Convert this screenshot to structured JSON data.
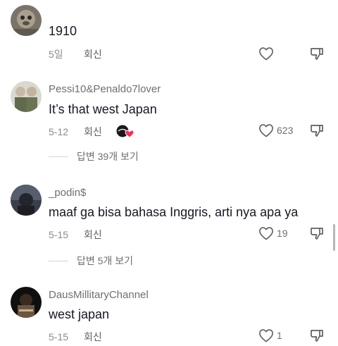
{
  "comments": [
    {
      "username": "",
      "text": "1910",
      "date": "5일",
      "reply_label": "회신",
      "like_count": ""
    },
    {
      "username": "Pessi10&Penaldo7lover",
      "text": "It’s that west Japan",
      "date": "5-12",
      "reply_label": "회신",
      "like_count": "623",
      "view_replies": "답변 39개 보기"
    },
    {
      "username": "_podin$",
      "text": "maaf ga bisa bahasa Inggris, arti nya apa ya",
      "date": "5-15",
      "reply_label": "회신",
      "like_count": "19",
      "view_replies": "답변 5개 보기"
    },
    {
      "username": "DausMillitaryChannel",
      "text": "west japan",
      "date": "5-15",
      "reply_label": "회신",
      "like_count": "1"
    }
  ],
  "icons": {
    "like": "heart-outline-icon",
    "dislike": "thumbs-down-icon",
    "creator_liked": "creator-liked-badge-icon"
  },
  "colors": {
    "text_primary": "#161823",
    "text_secondary": "#8a8b91",
    "badge_heart": "#fe2c55"
  }
}
